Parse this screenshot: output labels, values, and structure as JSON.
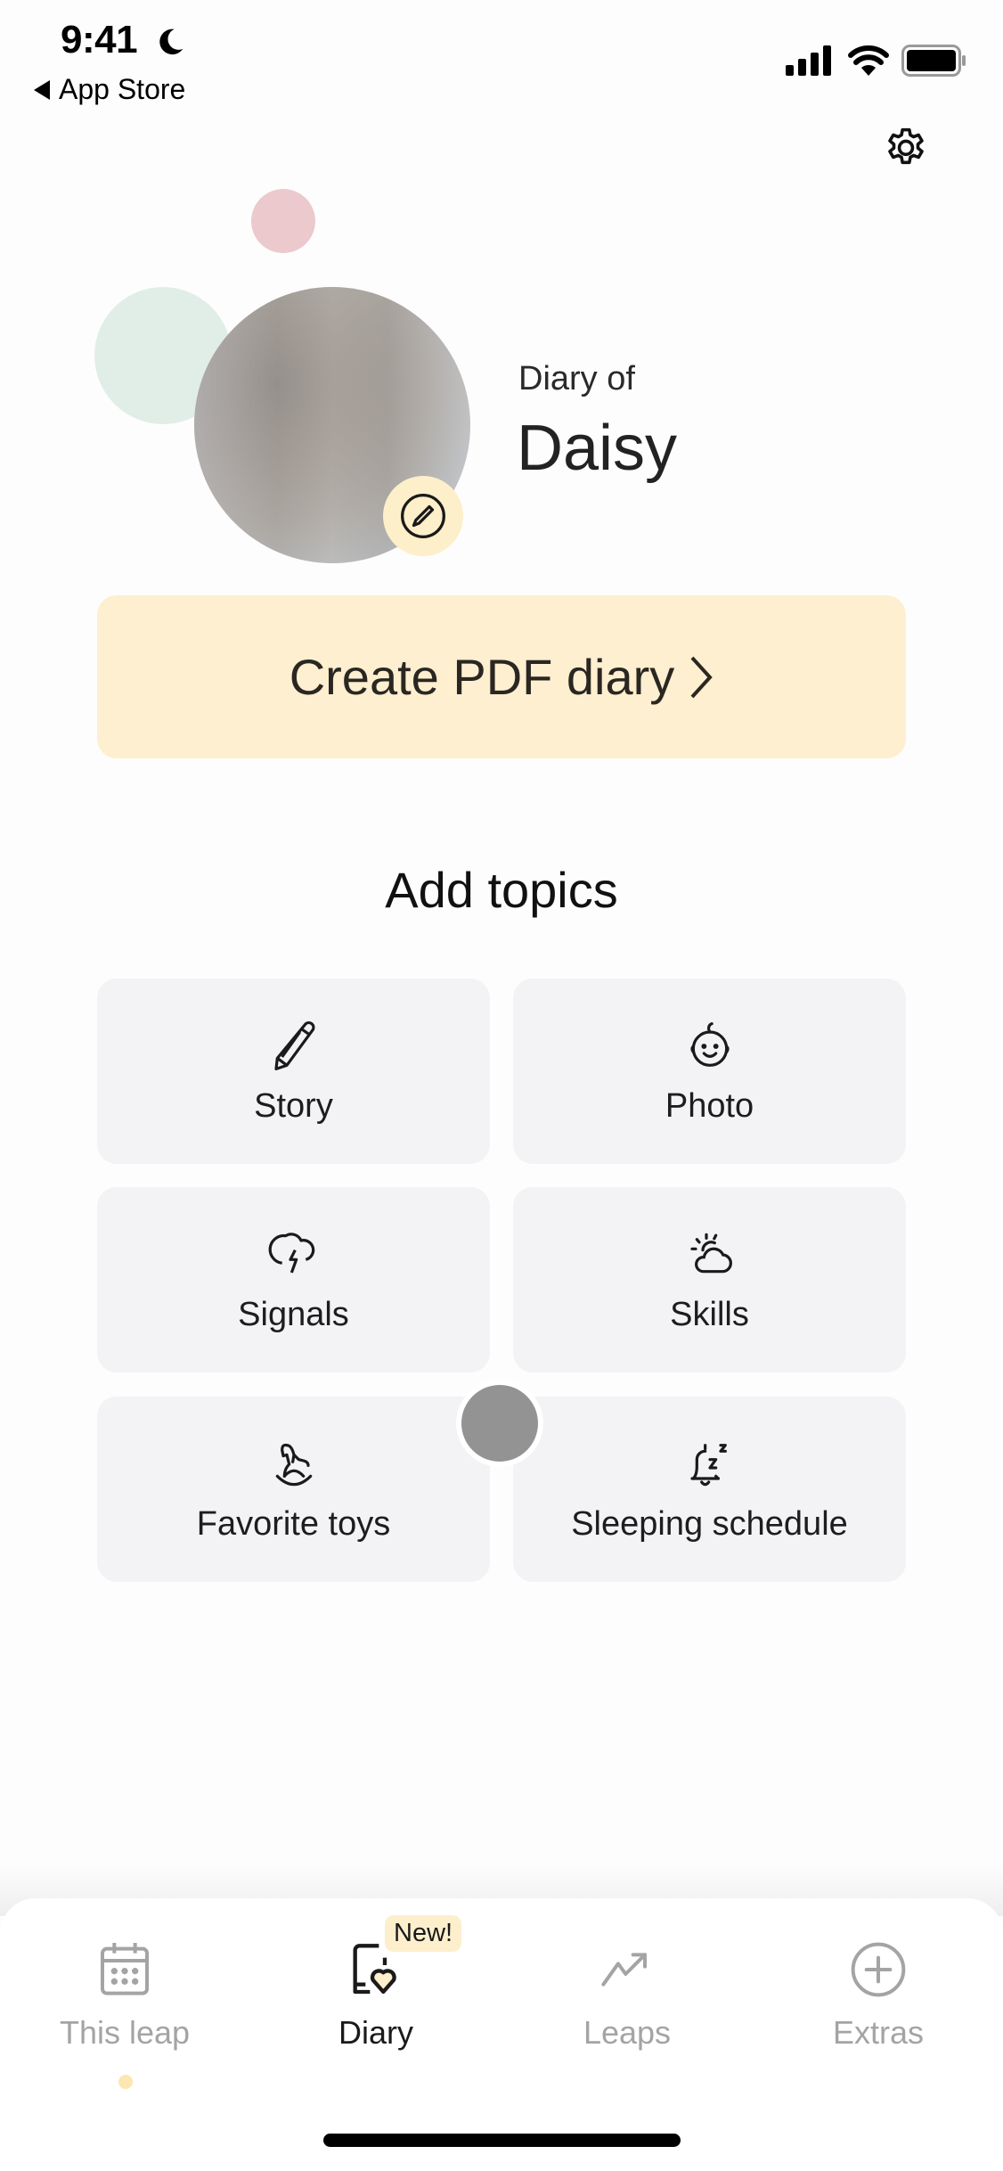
{
  "status_bar": {
    "time": "9:41",
    "focus_icon": "moon-icon",
    "back_label": "App Store",
    "icons": [
      "cellular-signal-icon",
      "wifi-icon",
      "battery-icon"
    ]
  },
  "header": {
    "settings_icon": "gear-icon"
  },
  "profile": {
    "subtitle": "Diary of",
    "name": "Daisy",
    "edit_icon": "pencil-circle-icon",
    "accent_colors": {
      "pink": "#ebc9cd",
      "green": "#e1eee8",
      "yellow": "#fdefcf"
    }
  },
  "create_pdf": {
    "label": "Create PDF diary",
    "icon": "chevron-right-icon"
  },
  "topics": {
    "title": "Add topics",
    "items": [
      {
        "label": "Story",
        "icon": "pencil-icon"
      },
      {
        "label": "Photo",
        "icon": "baby-face-icon"
      },
      {
        "label": "Signals",
        "icon": "storm-cloud-icon"
      },
      {
        "label": "Skills",
        "icon": "sun-cloud-icon"
      },
      {
        "label": "Favorite toys",
        "icon": "rocking-horse-icon"
      },
      {
        "label": "Sleeping schedule",
        "icon": "bell-sleep-icon"
      }
    ]
  },
  "tab_bar": {
    "items": [
      {
        "label": "This leap",
        "icon": "calendar-icon",
        "active": false
      },
      {
        "label": "Diary",
        "icon": "diary-heart-icon",
        "active": true,
        "badge": "New!"
      },
      {
        "label": "Leaps",
        "icon": "trending-up-icon",
        "active": false
      },
      {
        "label": "Extras",
        "icon": "plus-circle-icon",
        "active": false
      }
    ]
  }
}
